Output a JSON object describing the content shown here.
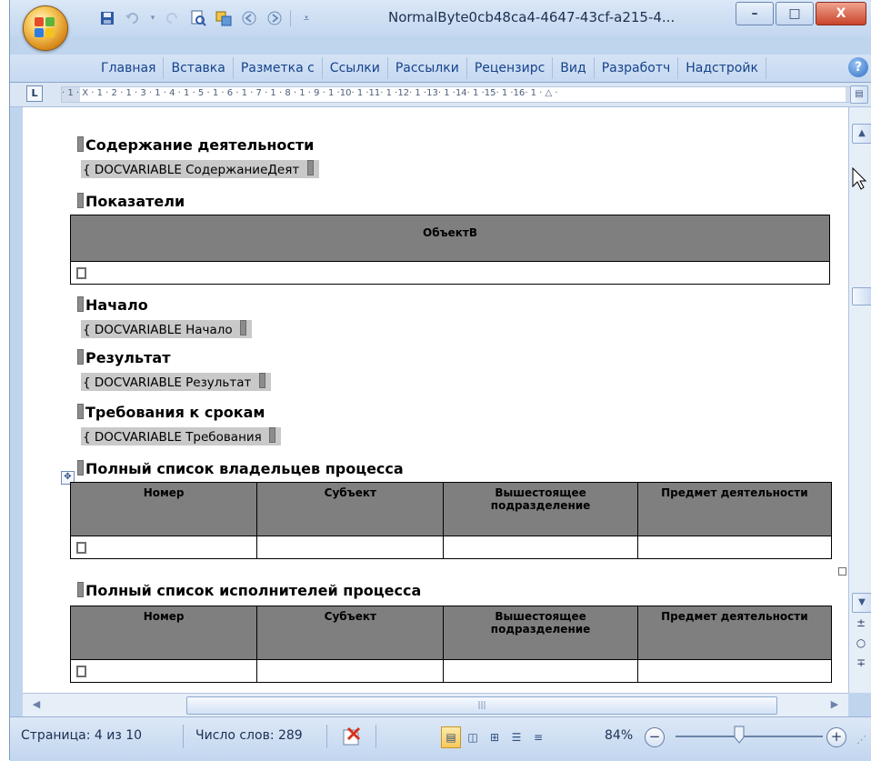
{
  "window": {
    "title": "NormalByte0cb48ca4-4647-43cf-a215-4...",
    "minimize_glyph": "–",
    "maximize_glyph": "□",
    "close_glyph": "X"
  },
  "quick_access": {
    "icons": [
      "save-icon",
      "undo-icon",
      "redo-icon",
      "print-preview-icon",
      "translate-icon",
      "back-icon",
      "forward-icon",
      "customize-icon"
    ]
  },
  "ribbon": {
    "tabs": [
      "Главная",
      "Вставка",
      "Разметка с",
      "Ссылки",
      "Рассылки",
      "Рецензирс",
      "Вид",
      "Разработч",
      "Надстройк"
    ],
    "help_glyph": "?"
  },
  "ruler": {
    "corner_glyph": "L",
    "text": "· 1 · X · 1 · 2 · 1 · 3 · 1 · 4 · 1 · 5 · 1 · 6 · 1 · 7 · 1 · 8 · 1 · 9 · 1 ·10· 1 ·11· 1 ·12· 1 ·13· 1 ·14· 1 ·15· 1 ·16· 1 · △ ·"
  },
  "document": {
    "sections": [
      {
        "heading": "Содержание деятельности",
        "field": "{ DOCVARIABLE СодержаниеДеят"
      },
      {
        "heading": "Показатели"
      },
      {
        "heading": "Начало",
        "field": "{ DOCVARIABLE Начало"
      },
      {
        "heading": "Результат",
        "field": "{ DOCVARIABLE Результат"
      },
      {
        "heading": "Требования к срокам",
        "field": "{ DOCVARIABLE Требования"
      },
      {
        "heading": "Полный список владельцев процесса"
      },
      {
        "heading": "Полный список исполнителей процесса"
      }
    ],
    "table_indicators": {
      "header": "ОбъектВ"
    },
    "table_owners": {
      "headers": [
        "Номер",
        "Субъект",
        "Вышестоящее подразделение",
        "Предмет деятельности"
      ]
    },
    "table_executors": {
      "headers": [
        "Номер",
        "Субъект",
        "Вышестоящее подразделение",
        "Предмет деятельности"
      ]
    },
    "move_handle_glyph": "✥"
  },
  "scrollbar": {
    "up_glyph": "▲",
    "down_glyph": "▼",
    "prev_glyph": "±",
    "browse_glyph": "○",
    "next_glyph": "∓",
    "left_glyph": "◀",
    "right_glyph": "▶",
    "grip_glyph": "|||"
  },
  "status": {
    "page": "Страница: 4 из 10",
    "words": "Число слов: 289",
    "zoom": "84%",
    "zoom_minus": "−",
    "zoom_plus": "+"
  }
}
